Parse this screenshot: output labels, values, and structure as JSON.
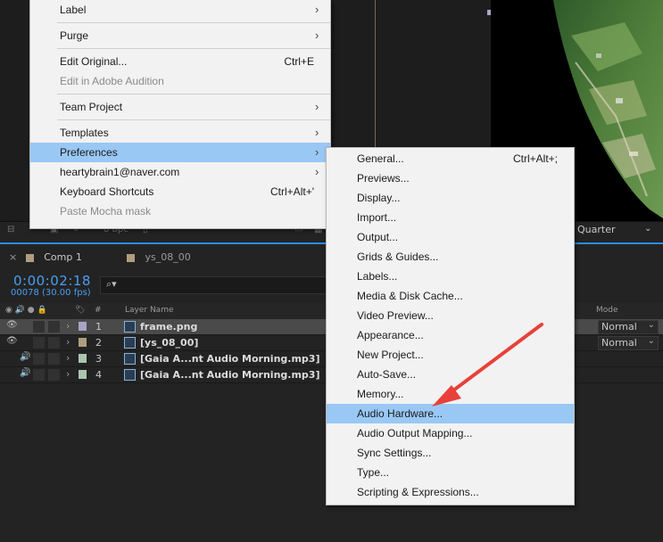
{
  "menu_main": {
    "items": [
      {
        "label": "Label",
        "submenu": true
      },
      {
        "separator": true
      },
      {
        "label": "Purge",
        "submenu": true
      },
      {
        "separator": true
      },
      {
        "label": "Edit Original...",
        "shortcut": "Ctrl+E"
      },
      {
        "label": "Edit in Adobe Audition",
        "disabled": true
      },
      {
        "separator": true
      },
      {
        "label": "Team Project",
        "submenu": true
      },
      {
        "separator": true
      },
      {
        "label": "Templates",
        "submenu": true
      },
      {
        "label": "Preferences",
        "submenu": true,
        "highlighted": true
      },
      {
        "label": "heartybrain1@naver.com",
        "submenu": true
      },
      {
        "label": "Keyboard Shortcuts",
        "shortcut": "Ctrl+Alt+'"
      },
      {
        "label": "Paste Mocha mask",
        "disabled": true
      }
    ],
    "submenu_glyph": "›"
  },
  "menu_preferences": {
    "items": [
      {
        "label": "General...",
        "shortcut": "Ctrl+Alt+;"
      },
      {
        "label": "Previews..."
      },
      {
        "label": "Display..."
      },
      {
        "label": "Import..."
      },
      {
        "label": "Output..."
      },
      {
        "label": "Grids & Guides..."
      },
      {
        "label": "Labels..."
      },
      {
        "label": "Media & Disk Cache..."
      },
      {
        "label": "Video Preview..."
      },
      {
        "label": "Appearance..."
      },
      {
        "label": "New Project..."
      },
      {
        "label": "Auto-Save..."
      },
      {
        "label": "Memory..."
      },
      {
        "label": "Audio Hardware...",
        "highlighted": true
      },
      {
        "label": "Audio Output Mapping..."
      },
      {
        "label": "Sync Settings..."
      },
      {
        "label": "Type..."
      },
      {
        "label": "Scripting & Expressions..."
      }
    ]
  },
  "viewer": {
    "bpc": "8 bpc",
    "quality": "Quarter",
    "quality_caret": "⌄"
  },
  "timeline": {
    "tab_label": "Comp 1",
    "tab_close": "×",
    "tab2_label": "ys_08_00",
    "timecode": "0:00:02:18",
    "frames": "00078 (30.00 fps)",
    "search_icon": "⌕▾",
    "columns": {
      "switches": "◉ 🔊 ● 🔒",
      "label": "🏷",
      "num": "#",
      "layer_name": "Layer Name",
      "mode": "Mode"
    },
    "layers": [
      {
        "num": "1",
        "name": "frame.png",
        "mode": "Normal",
        "color": "#a8a4c8",
        "selected": true,
        "kind": "video"
      },
      {
        "num": "2",
        "name": "[ys_08_00]",
        "mode": "Normal",
        "color": "#b09d7e",
        "selected": false,
        "kind": "video"
      },
      {
        "num": "3",
        "name": "[Gaia A...nt Audio Morning.mp3]",
        "mode": "",
        "color": "#a9c6b0",
        "selected": false,
        "kind": "audio"
      },
      {
        "num": "4",
        "name": "[Gaia A...nt Audio Morning.mp3]",
        "mode": "",
        "color": "#a9c6b0",
        "selected": false,
        "kind": "audio"
      }
    ],
    "eye_glyph": "👁",
    "speaker_glyph": "🔊",
    "arrow_glyph": "›",
    "mode_caret": "⌄"
  },
  "colors": {
    "highlight": "#99c8f5",
    "timecode_blue": "#4a9ef1",
    "annotation_red": "#e8413a"
  }
}
